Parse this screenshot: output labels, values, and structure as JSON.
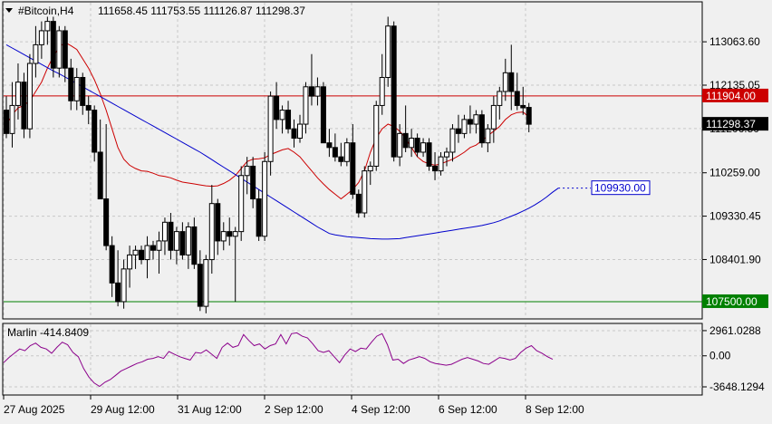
{
  "chart_data": [
    {
      "type": "candlestick",
      "panel": "price",
      "symbol_label": "#Bitcoin,H4",
      "ohlc_label": "111658.45 111753.55 111126.87 111298.37",
      "y_ticks": [
        "113063.60",
        "112135.05",
        "111206.50",
        "110259.00",
        "109330.45",
        "108401.90"
      ],
      "ylim": [
        107150,
        113900
      ],
      "x_ticks": [
        "27 Aug 2025",
        "29 Aug 12:00",
        "31 Aug 12:00",
        "2 Sep 12:00",
        "4 Sep 12:00",
        "6 Sep 12:00",
        "8 Sep 12:00"
      ],
      "hlines": [
        {
          "label": "111904.00",
          "value": 111904,
          "color": "#cc0000"
        },
        {
          "label": "107500.00",
          "value": 107500,
          "color": "#008000"
        }
      ],
      "current_price": {
        "label": "111298.37",
        "value": 111298.37
      },
      "projection_label": {
        "label": "109930.00",
        "value": 109930
      },
      "candles": [
        [
          111600,
          111900,
          111000,
          111100
        ],
        [
          111100,
          112200,
          110800,
          111700
        ],
        [
          111700,
          112600,
          111400,
          112200
        ],
        [
          112200,
          112400,
          111000,
          111200
        ],
        [
          111200,
          112800,
          111000,
          112600
        ],
        [
          112600,
          113400,
          112300,
          113000
        ],
        [
          113000,
          113500,
          112700,
          113300
        ],
        [
          113300,
          113600,
          113000,
          113500
        ],
        [
          113500,
          113600,
          112300,
          112500
        ],
        [
          112500,
          113400,
          112300,
          113300
        ],
        [
          113300,
          113400,
          112200,
          112500
        ],
        [
          112500,
          112700,
          111600,
          111800
        ],
        [
          111800,
          112500,
          111600,
          112300
        ],
        [
          112300,
          112400,
          111500,
          111700
        ],
        [
          111700,
          111900,
          111300,
          111600
        ],
        [
          111600,
          111700,
          110500,
          110700
        ],
        [
          110700,
          111400,
          109700,
          109700
        ],
        [
          109700,
          111300,
          108600,
          108700
        ],
        [
          108700,
          108900,
          107600,
          107900
        ],
        [
          107900,
          108600,
          107400,
          107500
        ],
        [
          107500,
          108400,
          107350,
          108200
        ],
        [
          108200,
          108700,
          107800,
          108500
        ],
        [
          108500,
          108700,
          108200,
          108600
        ],
        [
          108600,
          108700,
          108300,
          108400
        ],
        [
          108400,
          108900,
          108000,
          108700
        ],
        [
          108700,
          108800,
          108400,
          108600
        ],
        [
          108600,
          109000,
          108100,
          108800
        ],
        [
          108800,
          109300,
          108500,
          109200
        ],
        [
          109200,
          109400,
          108400,
          108600
        ],
        [
          108600,
          109100,
          108300,
          109000
        ],
        [
          109000,
          109200,
          108400,
          108500
        ],
        [
          108500,
          109200,
          108200,
          109100
        ],
        [
          109100,
          109300,
          108200,
          108300
        ],
        [
          108300,
          108600,
          107300,
          107400
        ],
        [
          107400,
          108500,
          107250,
          108400
        ],
        [
          108400,
          110000,
          108100,
          109600
        ],
        [
          109600,
          109700,
          108500,
          108800
        ],
        [
          108800,
          109200,
          108600,
          109000
        ],
        [
          109000,
          109300,
          108700,
          108900
        ],
        [
          108900,
          109100,
          107500,
          109000
        ],
        [
          109000,
          110400,
          108800,
          110200
        ],
        [
          110200,
          110600,
          109800,
          110400
        ],
        [
          110400,
          110600,
          109500,
          109700
        ],
        [
          109700,
          109900,
          108800,
          108900
        ],
        [
          108900,
          110700,
          108800,
          110500
        ],
        [
          110500,
          112000,
          110200,
          111900
        ],
        [
          111900,
          112200,
          111200,
          111400
        ],
        [
          111400,
          111700,
          111100,
          111600
        ],
        [
          111600,
          111800,
          111100,
          111200
        ],
        [
          111200,
          111400,
          110800,
          111000
        ],
        [
          111000,
          111500,
          110900,
          111300
        ],
        [
          111300,
          112200,
          111100,
          112100
        ],
        [
          112100,
          112800,
          111700,
          111900
        ],
        [
          111900,
          112300,
          111700,
          112100
        ],
        [
          112100,
          112200,
          110900,
          110900
        ],
        [
          110900,
          111200,
          110600,
          110800
        ],
        [
          110800,
          111100,
          110500,
          110600
        ],
        [
          110600,
          110900,
          110400,
          110500
        ],
        [
          110500,
          111000,
          110400,
          110900
        ],
        [
          110900,
          111300,
          109700,
          109800
        ],
        [
          109800,
          109900,
          109300,
          109400
        ],
        [
          109400,
          110400,
          109300,
          110300
        ],
        [
          110300,
          110500,
          110000,
          110400
        ],
        [
          110400,
          111800,
          110300,
          111700
        ],
        [
          111700,
          112800,
          111500,
          112300
        ],
        [
          112300,
          113600,
          112100,
          113400
        ],
        [
          113400,
          113500,
          110500,
          110600
        ],
        [
          110600,
          111300,
          110400,
          111100
        ],
        [
          111100,
          111700,
          110700,
          110800
        ],
        [
          110800,
          111200,
          110600,
          111000
        ],
        [
          111000,
          111100,
          110600,
          110700
        ],
        [
          110700,
          111000,
          110600,
          110900
        ],
        [
          110900,
          111000,
          110300,
          110400
        ],
        [
          110400,
          110700,
          110100,
          110300
        ],
        [
          110300,
          110700,
          110200,
          110600
        ],
        [
          110600,
          110800,
          110400,
          110700
        ],
        [
          110700,
          111300,
          110500,
          111200
        ],
        [
          111200,
          111500,
          110900,
          111100
        ],
        [
          111100,
          111500,
          111000,
          111400
        ],
        [
          111400,
          111700,
          111100,
          111300
        ],
        [
          111300,
          111600,
          111100,
          111500
        ],
        [
          111500,
          111600,
          110800,
          110900
        ],
        [
          110900,
          111300,
          110700,
          111200
        ],
        [
          111200,
          111900,
          110900,
          111700
        ],
        [
          111700,
          112100,
          111400,
          112000
        ],
        [
          112000,
          112700,
          111800,
          112400
        ],
        [
          112400,
          113000,
          111600,
          112000
        ],
        [
          112000,
          112400,
          111600,
          111700
        ],
        [
          111700,
          112100,
          111500,
          111650
        ],
        [
          111658.45,
          111753.55,
          111126.87,
          111298.37
        ]
      ],
      "series": [
        {
          "name": "",
          "color": "#cc0000",
          "values": [
            111300,
            111500,
            111650,
            111700,
            111800,
            112000,
            112200,
            112500,
            112750,
            112950,
            113050,
            112980,
            112900,
            112700,
            112500,
            112250,
            111950,
            111600,
            111200,
            110800,
            110550,
            110420,
            110350,
            110300,
            110290,
            110250,
            110200,
            110180,
            110150,
            110100,
            110060,
            110040,
            110020,
            110000,
            109980,
            109970,
            109980,
            110030,
            110100,
            110200,
            110350,
            110500,
            110550,
            110560,
            110580,
            110650,
            110700,
            110750,
            110780,
            110700,
            110600,
            110450,
            110300,
            110150,
            110020,
            109900,
            109800,
            109700,
            109800,
            109900,
            110050,
            110300,
            110700,
            111000,
            111200,
            111300,
            111250,
            111150,
            111000,
            110800,
            110600,
            110500,
            110450,
            110420,
            110450,
            110500,
            110550,
            110620,
            110700,
            110800,
            110850,
            110950,
            111050,
            111150,
            111250,
            111400,
            111500,
            111550,
            111560,
            111450
          ]
        },
        {
          "name": "",
          "color": "#0000cc",
          "values": [
            113000,
            112930,
            112860,
            112790,
            112720,
            112650,
            112580,
            112510,
            112440,
            112380,
            112310,
            112240,
            112170,
            112100,
            112030,
            111960,
            111890,
            111820,
            111750,
            111680,
            111610,
            111540,
            111470,
            111400,
            111330,
            111260,
            111190,
            111120,
            111050,
            110980,
            110910,
            110840,
            110770,
            110700,
            110620,
            110540,
            110460,
            110380,
            110300,
            110220,
            110140,
            110060,
            109980,
            109900,
            109820,
            109740,
            109660,
            109580,
            109500,
            109420,
            109340,
            109260,
            109180,
            109100,
            109030,
            108960,
            108930,
            108910,
            108890,
            108880,
            108870,
            108860,
            108850,
            108845,
            108840,
            108840,
            108845,
            108850,
            108870,
            108890,
            108910,
            108930,
            108950,
            108970,
            108990,
            109010,
            109030,
            109050,
            109070,
            109090,
            109110,
            109130,
            109160,
            109190,
            109230,
            109280,
            109330,
            109380,
            109440,
            109500,
            109570,
            109650,
            109740,
            109840,
            109930
          ]
        }
      ]
    },
    {
      "type": "line",
      "panel": "oscillator",
      "indicator_label": "Marlin -414.8409",
      "y_ticks": [
        "2961.0288",
        "0.00",
        "-3648.1294"
      ],
      "ylim": [
        -4500,
        3700
      ],
      "series": [
        {
          "name": "Marlin",
          "color": "#8b008b",
          "values": [
            -800,
            -200,
            300,
            800,
            600,
            1200,
            1500,
            1000,
            800,
            300,
            1000,
            1600,
            1300,
            400,
            -100,
            -1500,
            -2500,
            -3200,
            -3600,
            -3100,
            -2800,
            -2300,
            -1800,
            -1500,
            -1200,
            -900,
            -700,
            -400,
            -300,
            -100,
            -300,
            500,
            200,
            -100,
            -300,
            -500,
            400,
            300,
            700,
            200,
            -300,
            1000,
            1500,
            1000,
            1200,
            2500,
            1800,
            1200,
            1400,
            800,
            1200,
            1400,
            2500,
            1400,
            2600,
            2700,
            2300,
            2100,
            1400,
            600,
            400,
            600,
            -100,
            -800,
            100,
            800,
            500,
            900,
            800,
            1600,
            2300,
            2600,
            1300,
            -500,
            -400,
            -900,
            -500,
            -300,
            -100,
            -300,
            -700,
            -900,
            -1000,
            -1100,
            -1000,
            -700,
            -400,
            -200,
            -400,
            -600,
            -900,
            -1000,
            -600,
            -200,
            -300,
            -500,
            -300,
            400,
            900,
            1200,
            600,
            300,
            -100,
            -415
          ]
        }
      ]
    }
  ]
}
